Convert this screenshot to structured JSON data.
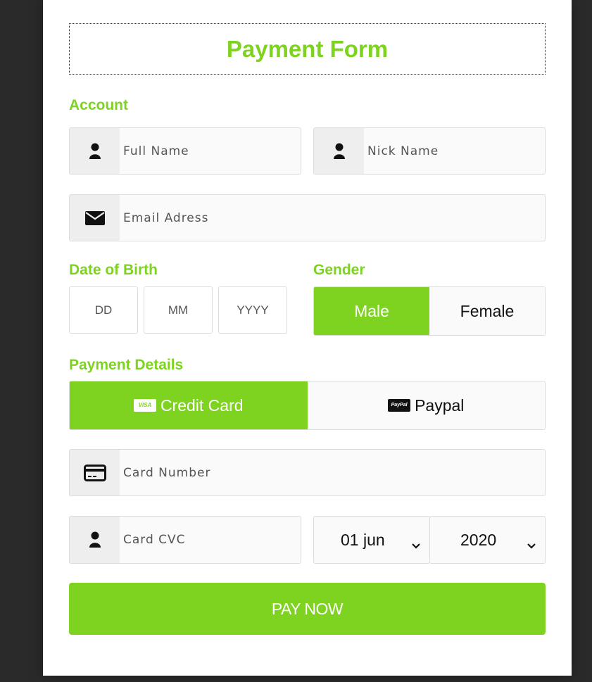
{
  "form": {
    "title": "Payment Form"
  },
  "account": {
    "label": "Account",
    "full_name_placeholder": "Full Name",
    "nick_name_placeholder": "Nick Name",
    "email_placeholder": "Email Adress"
  },
  "dob": {
    "label": "Date of Birth",
    "dd_placeholder": "DD",
    "mm_placeholder": "MM",
    "yyyy_placeholder": "YYYY"
  },
  "gender": {
    "label": "Gender",
    "options": [
      "Male",
      "Female"
    ],
    "selected": "Male"
  },
  "payment": {
    "label": "Payment Details",
    "methods": [
      {
        "label": "Credit Card",
        "badge": "VISA",
        "icon": "visa-card-icon"
      },
      {
        "label": "Paypal",
        "badge": "PayPal",
        "icon": "paypal-icon"
      }
    ],
    "selected_method": "Credit Card",
    "card_number_placeholder": "Card Number",
    "card_cvc_placeholder": "Card CVC",
    "expiry_day_month": "01 jun",
    "expiry_year": "2020"
  },
  "submit": {
    "label": "PAY NOW"
  },
  "colors": {
    "accent": "#7ed321",
    "background": "#2a2a2a",
    "card": "#ffffff",
    "field_bg": "#fafafa",
    "icon_bg": "#eeeeee"
  },
  "icons": {
    "user": "user-icon",
    "email": "envelope-icon",
    "card": "credit-card-icon",
    "chevron": "chevron-down-icon"
  }
}
